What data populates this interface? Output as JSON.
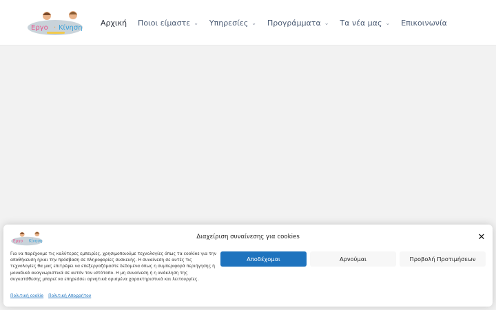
{
  "header": {
    "logo_alt": "logo",
    "nav": [
      {
        "label": "Αρχική",
        "has_dropdown": false,
        "active": true
      },
      {
        "label": "Ποιοι είμαστε",
        "has_dropdown": true,
        "active": false
      },
      {
        "label": "Υπηρεσίες",
        "has_dropdown": true,
        "active": false
      },
      {
        "label": "Προγράμματα",
        "has_dropdown": true,
        "active": false
      },
      {
        "label": "Τα νέα μας",
        "has_dropdown": true,
        "active": false
      },
      {
        "label": "Επικοινωνία",
        "has_dropdown": false,
        "active": false
      }
    ],
    "caret": "⌄"
  },
  "cookie": {
    "title": "Διαχείριση συναίνεσης για cookies",
    "close_icon": "✕",
    "text": "Για να παρέχουμε τις καλύτερες εμπειρίες, χρησιμοποιούμε τεχνολογίες όπως τα cookies για την αποθήκευση ή/και την πρόσβαση σε πληροφορίες συσκευής. Η συναίνεση σε αυτές τις τεχνολογίες θα μας επιτρέψει να επεξεργαζόμαστε δεδομένα όπως η συμπεριφορά περιήγησης ή μοναδικά αναγνωριστικά σε αυτόν τον ιστότοπο. Η μη συναίνεση ή η ανάκληση της συγκατάθεσης μπορεί να επηρεάσει αρνητικά ορισμένα χαρακτηριστικά και λειτουργίες.",
    "accept_label": "Αποδέχομαι",
    "deny_label": "Αρνούμαι",
    "prefs_label": "Προβολή Προτιμήσεων",
    "cookie_policy": "Πολιτική cookie",
    "privacy_policy": "Πολιτική Απορρήτου"
  },
  "colors": {
    "accent": "#1e73be",
    "page_bg": "#f2f2f2"
  }
}
